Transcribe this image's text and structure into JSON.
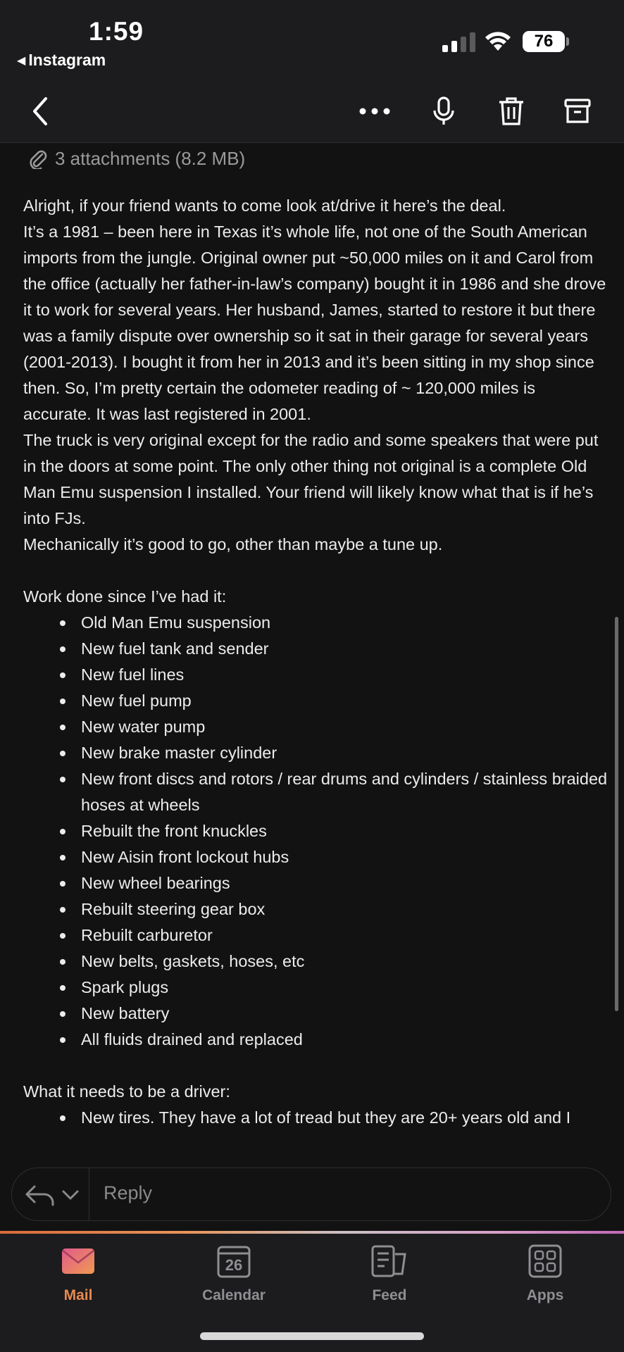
{
  "status_bar": {
    "time": "1:59",
    "back_app": "Instagram",
    "battery": "76"
  },
  "toolbar": {
    "icons": [
      "back-chevron-icon",
      "more-icon",
      "microphone-icon",
      "trash-icon",
      "archive-icon"
    ]
  },
  "message": {
    "attachments": "3 attachments (8.2 MB)",
    "intro": "Alright, if your friend wants to come look at/drive it here’s the deal.",
    "paragraph1": "It’s a 1981 – been here in Texas it’s whole life, not one of the South American imports from the jungle. Original owner put ~50,000 miles on it and Carol from the office (actually her father-in-law’s company) bought it in 1986 and she drove it to work for several years. Her husband, James, started to restore it but there was a family dispute over ownership so it sat in their garage for several years (2001-2013). I bought it from her in 2013 and it’s been sitting in my shop since then. So, I’m pretty certain the odometer reading of ~ 120,000 miles is accurate. It was last registered in 2001.",
    "paragraph2": "The truck is very original except for the radio and some speakers that were put in the doors at some point. The only other thing not original is a complete Old Man Emu suspension I installed. Your friend will likely know what that is if he’s into FJs.",
    "paragraph3": "Mechanically it’s good to go, other than maybe a tune up.",
    "work_heading": "Work done since I’ve had it:",
    "work_items": [
      "Old Man Emu suspension",
      "New fuel tank and sender",
      "New fuel lines",
      "New fuel pump",
      "New water pump",
      "New brake master cylinder",
      "New front discs and rotors / rear drums and cylinders / stainless braided hoses at wheels",
      "Rebuilt the front knuckles",
      "New Aisin front lockout hubs",
      "New wheel bearings",
      "Rebuilt steering gear box",
      "Rebuilt carburetor",
      "New belts, gaskets, hoses, etc",
      "Spark plugs",
      "New battery",
      "All fluids drained and replaced"
    ],
    "needs_heading": "What it needs to be a driver:",
    "needs_items": [
      "New tires. They have a lot of tread but they are 20+ years old and I"
    ]
  },
  "reply": {
    "placeholder": "Reply"
  },
  "tabbar": {
    "mail": "Mail",
    "calendar": "Calendar",
    "calendar_day": "26",
    "feed": "Feed",
    "apps": "Apps"
  },
  "colors": {
    "accent": "#e8894f",
    "background": "#121212",
    "bar": "#1c1c1e"
  }
}
